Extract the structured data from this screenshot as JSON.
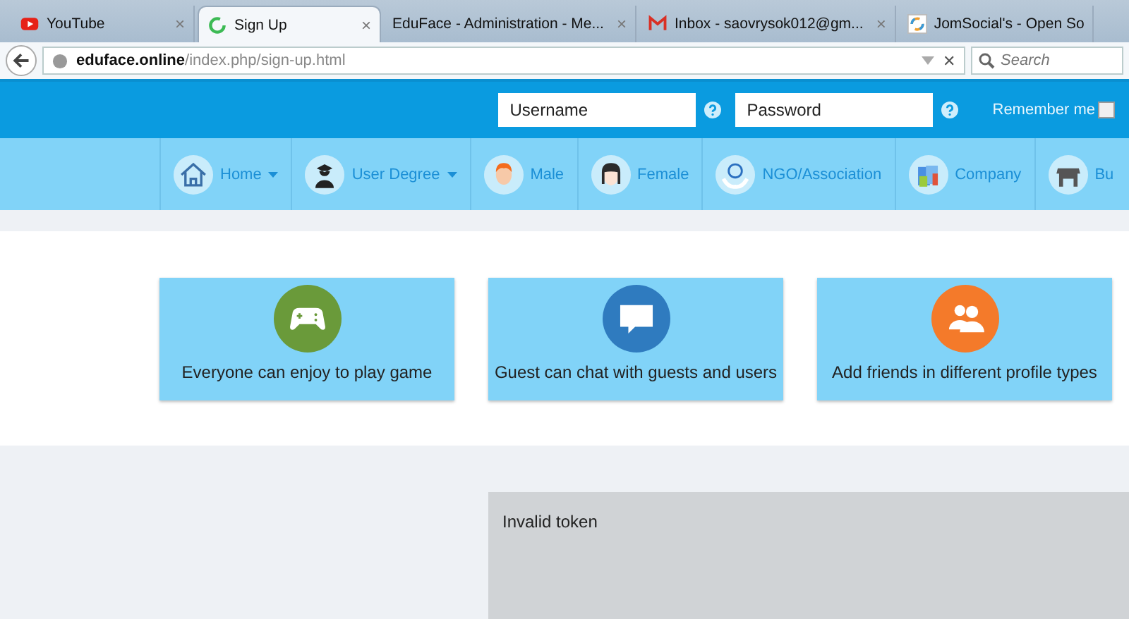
{
  "browser": {
    "tabs": [
      {
        "title": "YouTube",
        "selected": false,
        "close": "×"
      },
      {
        "title": "Sign Up",
        "selected": true,
        "close": "×"
      },
      {
        "title": "EduFace - Administration - Me...",
        "selected": false,
        "close": "×"
      },
      {
        "title": "Inbox - saovrysok012@gm...",
        "selected": false,
        "close": "×"
      },
      {
        "title": "JomSocial's - Open So",
        "selected": false
      }
    ],
    "address": {
      "host": "eduface.online",
      "path": "/index.php/sign-up.html",
      "clear": "✕"
    },
    "search": {
      "placeholder": "Search"
    }
  },
  "login": {
    "username": {
      "placeholder": "Username"
    },
    "password": {
      "placeholder": "Password"
    },
    "remember": {
      "label": "Remember me",
      "checked": false
    }
  },
  "nav": [
    {
      "label": "Home",
      "caret": true
    },
    {
      "label": "User Degree",
      "caret": true
    },
    {
      "label": "Male",
      "caret": false
    },
    {
      "label": "Female",
      "caret": false
    },
    {
      "label": "NGO/Association",
      "caret": false
    },
    {
      "label": "Company",
      "caret": false
    },
    {
      "label": "Bu",
      "caret": false
    }
  ],
  "features": [
    {
      "text": "Everyone can enjoy to play game",
      "color": "#6a9a3a"
    },
    {
      "text": "Guest can chat with guests and users",
      "color": "#2f7bbf"
    },
    {
      "text": "Add friends in different profile types",
      "color": "#f47a2a"
    }
  ],
  "message": {
    "text": "Invalid token"
  }
}
